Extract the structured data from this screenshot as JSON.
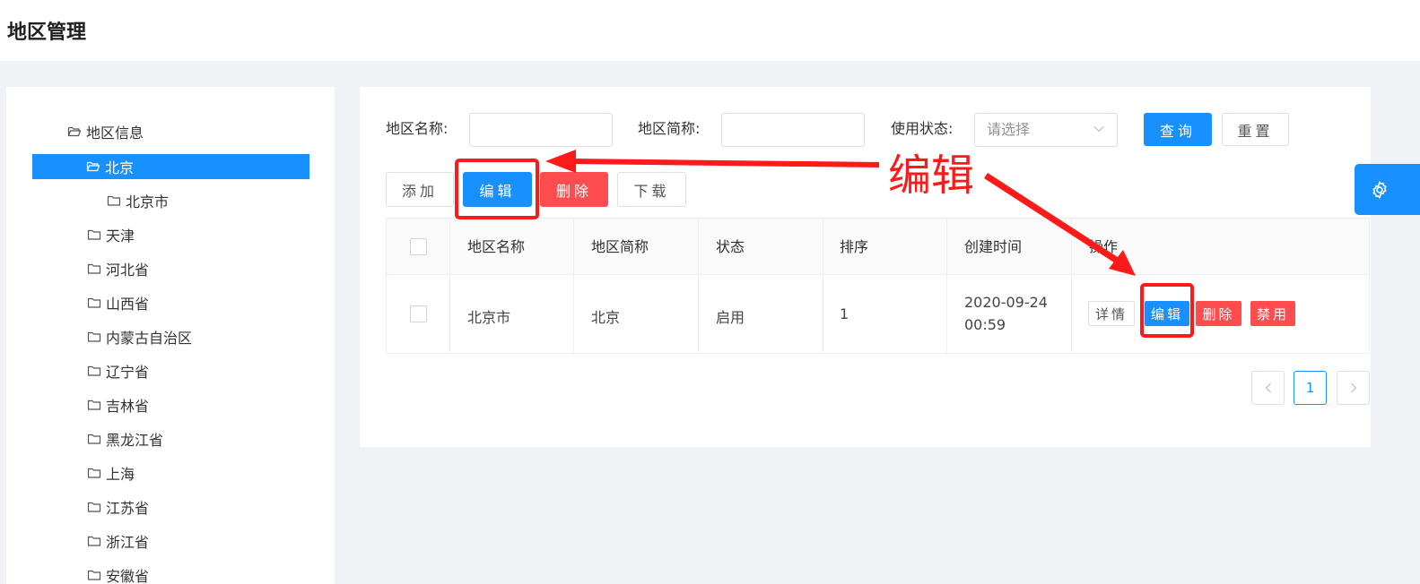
{
  "page": {
    "title": "地区管理"
  },
  "tree": {
    "root": "地区信息",
    "nodes": [
      "北京",
      "北京市",
      "天津",
      "河北省",
      "山西省",
      "内蒙古自治区",
      "辽宁省",
      "吉林省",
      "黑龙江省",
      "上海",
      "江苏省",
      "浙江省",
      "安徽省"
    ],
    "selected": "北京"
  },
  "search": {
    "name_label": "地区名称:",
    "name_value": "",
    "abbr_label": "地区简称:",
    "abbr_value": "",
    "status_label": "使用状态:",
    "status_placeholder": "请选择",
    "query_button": "查询",
    "reset_button": "重置"
  },
  "toolbar": {
    "add_button": "添加",
    "edit_button": "编辑",
    "delete_button": "删除",
    "download_button": "下载"
  },
  "table": {
    "columns": [
      "地区名称",
      "地区简称",
      "状态",
      "排序",
      "创建时间",
      "操作"
    ],
    "rows": [
      {
        "name": "北京市",
        "abbr": "北京",
        "status": "启用",
        "order": "1",
        "created_date": "2020-09-24",
        "created_time": "00:59"
      }
    ],
    "row_actions": {
      "detail": "详情",
      "edit": "编辑",
      "delete": "删除",
      "disable": "禁用"
    }
  },
  "pagination": {
    "current": "1",
    "prev_icon": "chevron-left-icon",
    "next_icon": "chevron-right-icon"
  },
  "settings": {
    "icon": "gear-icon"
  },
  "annotation": {
    "text": "编辑",
    "color": "#ff1a1a"
  },
  "colors": {
    "primary": "#1890ff",
    "danger": "#ff4d4f",
    "annotation": "#ff1a1a"
  }
}
